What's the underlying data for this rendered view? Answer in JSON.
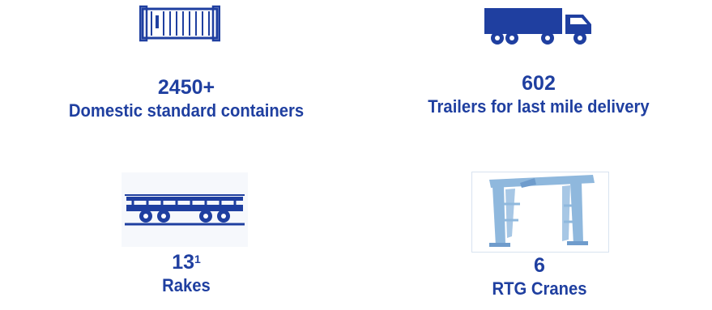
{
  "stats": [
    {
      "value": "2450+",
      "label": "Domestic standard containers",
      "icon": "shipping-container-icon"
    },
    {
      "value": "602",
      "label": "Trailers for last mile delivery",
      "icon": "truck-trailer-icon"
    },
    {
      "value": "13",
      "value_superscript": "1",
      "label": "Rakes",
      "icon": "rail-wagon-icon"
    },
    {
      "value": "6",
      "label": "RTG Cranes",
      "icon": "gantry-crane-icon"
    }
  ],
  "colors": {
    "text": "#1f3fa0",
    "icon_dark": "#1f3fa0",
    "icon_light": "#8fb8dd"
  }
}
